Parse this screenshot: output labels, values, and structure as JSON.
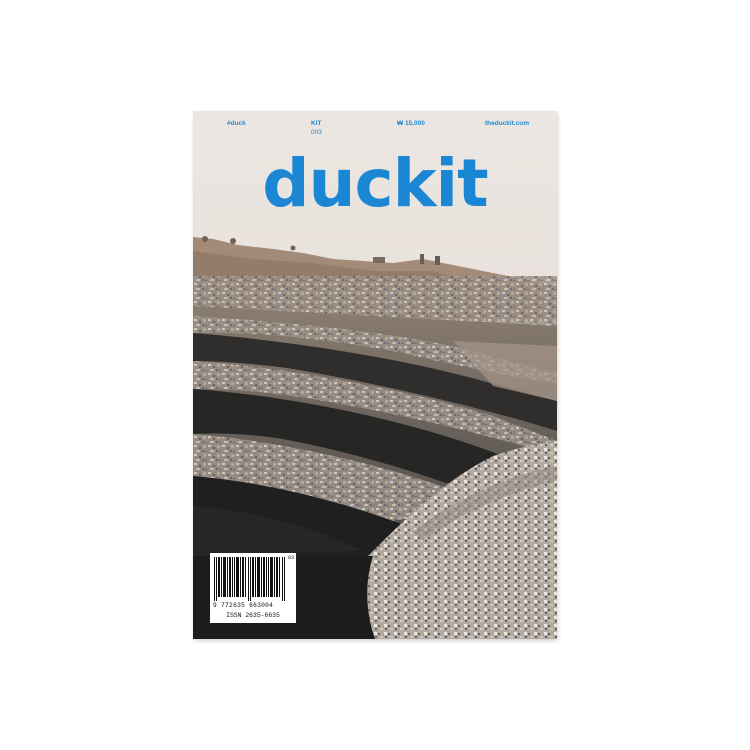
{
  "page": {
    "background": "#ffffff"
  },
  "magazine": {
    "masthead": "duckit",
    "masthead_color": "#1a86d4",
    "top_info": {
      "handle": "#duck",
      "issue_label": "KIT",
      "issue_number": "003",
      "price": "₩ 15,000",
      "website": "theduckit.com"
    },
    "cover_photo_subject": "landfill-landscape",
    "barcode": {
      "digits": "9 772635 663004",
      "issn": "ISSN 2635-6635",
      "issue_code": "03"
    }
  }
}
